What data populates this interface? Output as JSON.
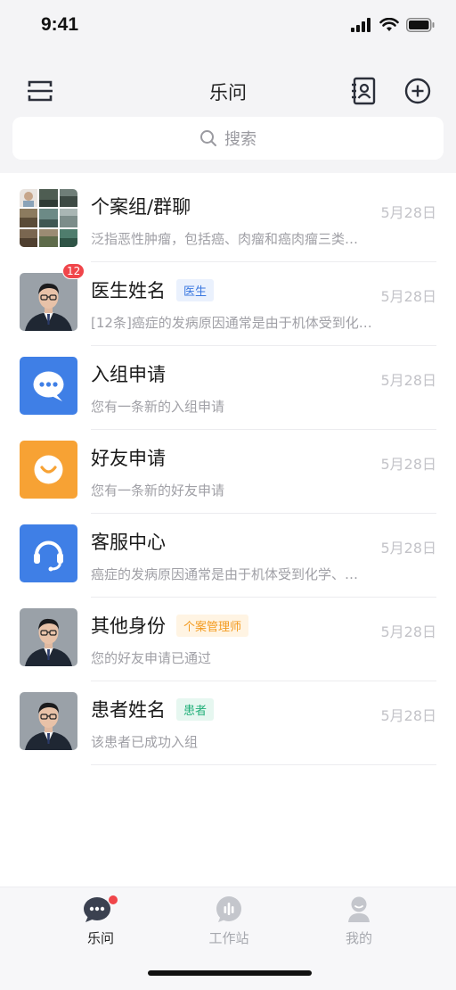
{
  "status": {
    "time": "9:41"
  },
  "nav": {
    "title": "乐问",
    "search_placeholder": "搜索"
  },
  "conversations": [
    {
      "title": "个案组/群聊",
      "tag": "",
      "date": "5月28日",
      "preview": "泛指恶性肿瘤，包括癌、肉瘤和癌肉瘤三类…",
      "avatar": "group-avatar"
    },
    {
      "title": "医生姓名",
      "tag": "医生",
      "tag_color": "#3a78e0",
      "date": "5月28日",
      "preview": "[12条]癌症的发病原因通常是由于机体受到化…",
      "avatar": "doctor-avatar",
      "badge": "12"
    },
    {
      "title": "入组申请",
      "tag": "",
      "date": "5月28日",
      "preview": "您有一条新的入组申请",
      "avatar": "chat-bubble-icon",
      "avatar_color": "#3f7fe6"
    },
    {
      "title": "好友申请",
      "tag": "",
      "date": "5月28日",
      "preview": "您有一条新的好友申请",
      "avatar": "smile-icon",
      "avatar_color": "#f7a234"
    },
    {
      "title": "客服中心",
      "tag": "",
      "date": "5月28日",
      "preview": "癌症的发病原因通常是由于机体受到化学、…",
      "avatar": "headset-icon",
      "avatar_color": "#3f7fe6"
    },
    {
      "title": "其他身份",
      "tag": "个案管理师",
      "tag_color": "#f39a1e",
      "date": "5月28日",
      "preview": "您的好友申请已通过",
      "avatar": "doctor-avatar"
    },
    {
      "title": "患者姓名",
      "tag": "患者",
      "tag_color": "#23b07a",
      "date": "5月28日",
      "preview": "该患者已成功入组",
      "avatar": "doctor-avatar"
    }
  ],
  "tabs": [
    {
      "label": "乐问",
      "icon": "chat-icon",
      "active": true
    },
    {
      "label": "工作站",
      "icon": "workstation-icon",
      "active": false
    },
    {
      "label": "我的",
      "icon": "profile-icon",
      "active": false
    }
  ],
  "colors": {
    "accent": "#3f7fe6",
    "badge": "#f0454a",
    "muted": "#a0a0a6"
  }
}
